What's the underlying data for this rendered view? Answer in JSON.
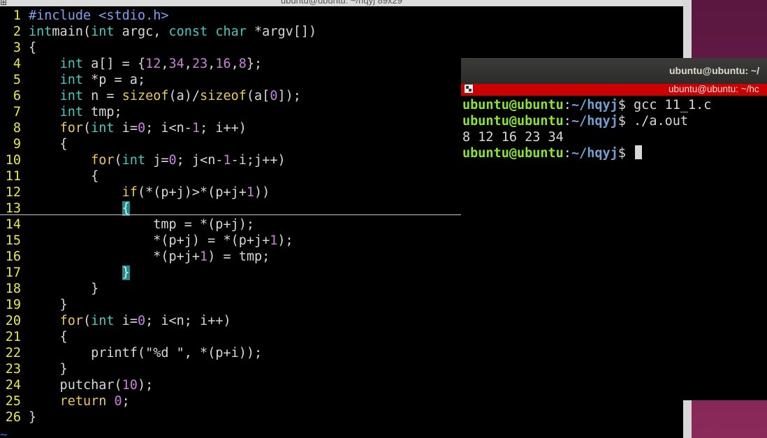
{
  "vim": {
    "window_title": "ubuntu@ubuntu: ~/hqyj 89x29",
    "tilde": "~",
    "lines": [
      {
        "n": "1",
        "segs": [
          [
            "pp",
            "#include <stdio.h>"
          ]
        ]
      },
      {
        "n": "2",
        "segs": [
          [
            "ty",
            "int"
          ],
          [
            "",
            "main("
          ],
          [
            "ty",
            "int"
          ],
          [
            "",
            " argc, "
          ],
          [
            "ty",
            "const char"
          ],
          [
            "",
            " *argv[])"
          ]
        ]
      },
      {
        "n": "3",
        "segs": [
          [
            "",
            "{"
          ]
        ]
      },
      {
        "n": "4",
        "segs": [
          [
            "",
            "    "
          ],
          [
            "ty",
            "int"
          ],
          [
            "",
            " a[] = {"
          ],
          [
            "numc",
            "12"
          ],
          [
            "",
            ","
          ],
          [
            "numc",
            "34"
          ],
          [
            "",
            ","
          ],
          [
            "numc",
            "23"
          ],
          [
            "",
            ","
          ],
          [
            "numc",
            "16"
          ],
          [
            "",
            ","
          ],
          [
            "numc",
            "8"
          ],
          [
            "",
            "};"
          ]
        ]
      },
      {
        "n": "5",
        "segs": [
          [
            "",
            "    "
          ],
          [
            "ty",
            "int"
          ],
          [
            "",
            " *p = a;"
          ]
        ]
      },
      {
        "n": "6",
        "segs": [
          [
            "",
            "    "
          ],
          [
            "ty",
            "int"
          ],
          [
            "",
            " n = "
          ],
          [
            "kw",
            "sizeof"
          ],
          [
            "",
            "(a)/"
          ],
          [
            "kw",
            "sizeof"
          ],
          [
            "",
            "(a["
          ],
          [
            "numc",
            "0"
          ],
          [
            "",
            "]);"
          ]
        ]
      },
      {
        "n": "7",
        "segs": [
          [
            "",
            "    "
          ],
          [
            "ty",
            "int"
          ],
          [
            "",
            " tmp;"
          ]
        ]
      },
      {
        "n": "8",
        "segs": [
          [
            "",
            "    "
          ],
          [
            "kw",
            "for"
          ],
          [
            "",
            "("
          ],
          [
            "ty",
            "int"
          ],
          [
            "",
            " i="
          ],
          [
            "numc",
            "0"
          ],
          [
            "",
            "; i<n-"
          ],
          [
            "numc",
            "1"
          ],
          [
            "",
            "; i++)"
          ]
        ]
      },
      {
        "n": "9",
        "segs": [
          [
            "",
            "    {"
          ]
        ]
      },
      {
        "n": "10",
        "segs": [
          [
            "",
            "        "
          ],
          [
            "kw",
            "for"
          ],
          [
            "",
            "("
          ],
          [
            "ty",
            "int"
          ],
          [
            "",
            " j="
          ],
          [
            "numc",
            "0"
          ],
          [
            "",
            "; j<n-"
          ],
          [
            "numc",
            "1"
          ],
          [
            "",
            "-i;j++)"
          ]
        ]
      },
      {
        "n": "11",
        "segs": [
          [
            "",
            "        {"
          ]
        ]
      },
      {
        "n": "12",
        "segs": [
          [
            "",
            "            "
          ],
          [
            "kw",
            "if"
          ],
          [
            "",
            "(*(p+j)>*(p+j+"
          ],
          [
            "numc",
            "1"
          ],
          [
            "",
            "))"
          ]
        ]
      },
      {
        "n": "13",
        "segs": [
          [
            "",
            "            "
          ],
          [
            "hl",
            "{"
          ]
        ]
      },
      {
        "n": "14",
        "segs": [
          [
            "",
            "                tmp = *(p+j);"
          ]
        ]
      },
      {
        "n": "15",
        "segs": [
          [
            "",
            "                *(p+j) = *(p+j+"
          ],
          [
            "numc",
            "1"
          ],
          [
            "",
            ");"
          ]
        ]
      },
      {
        "n": "16",
        "segs": [
          [
            "",
            "                *(p+j+"
          ],
          [
            "numc",
            "1"
          ],
          [
            "",
            ") = tmp;"
          ]
        ]
      },
      {
        "n": "17",
        "segs": [
          [
            "",
            "            "
          ],
          [
            "hl",
            "}"
          ]
        ]
      },
      {
        "n": "18",
        "segs": [
          [
            "",
            "        }"
          ]
        ]
      },
      {
        "n": "19",
        "segs": [
          [
            "",
            "    }"
          ]
        ]
      },
      {
        "n": "20",
        "segs": [
          [
            "",
            "    "
          ],
          [
            "kw",
            "for"
          ],
          [
            "",
            "("
          ],
          [
            "ty",
            "int"
          ],
          [
            "",
            " i="
          ],
          [
            "numc",
            "0"
          ],
          [
            "",
            "; i<n; i++)"
          ]
        ]
      },
      {
        "n": "21",
        "segs": [
          [
            "",
            "    {"
          ]
        ]
      },
      {
        "n": "22",
        "segs": [
          [
            "",
            "        printf("
          ],
          [
            "str",
            "\"%d \""
          ],
          [
            "",
            ", *(p+i));"
          ]
        ]
      },
      {
        "n": "23",
        "segs": [
          [
            "",
            "    }"
          ]
        ]
      },
      {
        "n": "24",
        "segs": [
          [
            "",
            "    putchar("
          ],
          [
            "numc",
            "10"
          ],
          [
            "",
            ");"
          ]
        ]
      },
      {
        "n": "25",
        "segs": [
          [
            "",
            "    "
          ],
          [
            "kw",
            "return"
          ],
          [
            "",
            " "
          ],
          [
            "numc",
            "0"
          ],
          [
            "",
            ";"
          ]
        ]
      },
      {
        "n": "26",
        "segs": [
          [
            "",
            "}"
          ]
        ]
      }
    ]
  },
  "terminal": {
    "title": "ubuntu@ubuntu: ~/",
    "tab_title": "ubuntu@ubuntu: ~/hc",
    "prompt_user": "ubuntu@ubuntu",
    "prompt_dir": "~/hqyj",
    "cmd1": " gcc 11_1.c",
    "cmd2": " ./a.out",
    "output": "8 12 16 23 34",
    "colors": {
      "tab_bar": "#cc0000",
      "prompt_user": "#8ae234",
      "prompt_dir": "#729fcf"
    }
  }
}
